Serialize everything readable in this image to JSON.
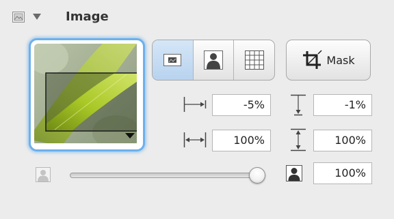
{
  "header": {
    "title": "Image",
    "icon": "image-icon",
    "disclosure_icon": "disclosure-triangle-down-icon"
  },
  "preview": {
    "icon": "image-preview-thumbnail",
    "menu_icon": "triangle-down-icon"
  },
  "scaling_segments": [
    {
      "icon": "fit-image-icon",
      "selected": true
    },
    {
      "icon": "fill-image-icon",
      "selected": false
    },
    {
      "icon": "tile-image-icon",
      "selected": false
    }
  ],
  "mask_button": {
    "label": "Mask",
    "icon": "crop-icon"
  },
  "offset": {
    "x": {
      "value": "-5%",
      "icon": "horizontal-offset-icon"
    },
    "y": {
      "value": "-1%",
      "icon": "vertical-offset-icon"
    }
  },
  "scale": {
    "width": {
      "value": "100%",
      "icon": "horizontal-scale-icon"
    },
    "height": {
      "value": "100%",
      "icon": "vertical-scale-icon"
    }
  },
  "opacity": {
    "value": "100%",
    "level": 1.0,
    "min_icon": "person-silhouette-light-icon",
    "max_icon": "person-silhouette-dark-icon"
  },
  "colors": {
    "selection_ring": "#6cb0ec",
    "active_segment": "#c8ddf3",
    "background": "#ececec"
  }
}
